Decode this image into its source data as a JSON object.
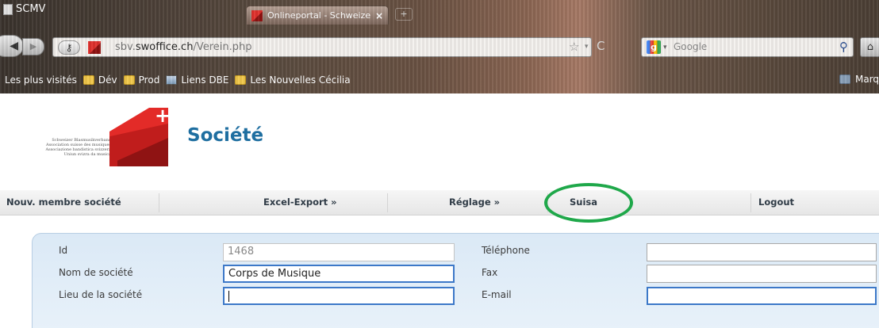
{
  "window": {
    "title": "SCMV"
  },
  "tab": {
    "title": "Onlineportal - Schweizerischer Blasm...",
    "close": "×"
  },
  "new_tab": "+",
  "nav": {
    "back": "◀",
    "forward": "▶"
  },
  "address_bar": {
    "url_prefix": "sbv.",
    "url_domain": "swoffice.ch",
    "url_path": "/Verein.php",
    "star": "☆",
    "dropdown": "▾",
    "reload": "C"
  },
  "search_bar": {
    "engine_letter": "g",
    "dropdown": "▾",
    "placeholder": "Google",
    "search_icon": "⚲"
  },
  "home": "⌂",
  "bookmarks": {
    "items": [
      "Les plus visités",
      "Dév",
      "Prod",
      "Liens DBE",
      "Les Nouvelles Cécilia"
    ],
    "right": "Marq"
  },
  "logo": {
    "lines": [
      "Schweizer Blasmusikverband",
      "Association suisse des musiques",
      "Associazione bandistica svizzera",
      "Uniun svizra da musica"
    ],
    "cross": "+"
  },
  "page": {
    "title": "Société"
  },
  "menu": {
    "new_member": "Nouv. membre société",
    "excel_export": "Excel-Export »",
    "settings": "Réglage »",
    "suisa": "Suisa",
    "logout": "Logout"
  },
  "form": {
    "id_label": "Id",
    "id_value": "1468",
    "name_label": "Nom de société",
    "name_value": "Corps de Musique",
    "place_label": "Lieu de la société",
    "place_value": "",
    "phone_label": "Téléphone",
    "phone_value": "",
    "fax_label": "Fax",
    "fax_value": "",
    "email_label": "E-mail",
    "email_value": ""
  },
  "colors": {
    "title_blue": "#1e6ea0",
    "highlight_green": "#1fa84a",
    "brand_red": "#e32b28",
    "panel_blue": "#dbe9f6"
  }
}
